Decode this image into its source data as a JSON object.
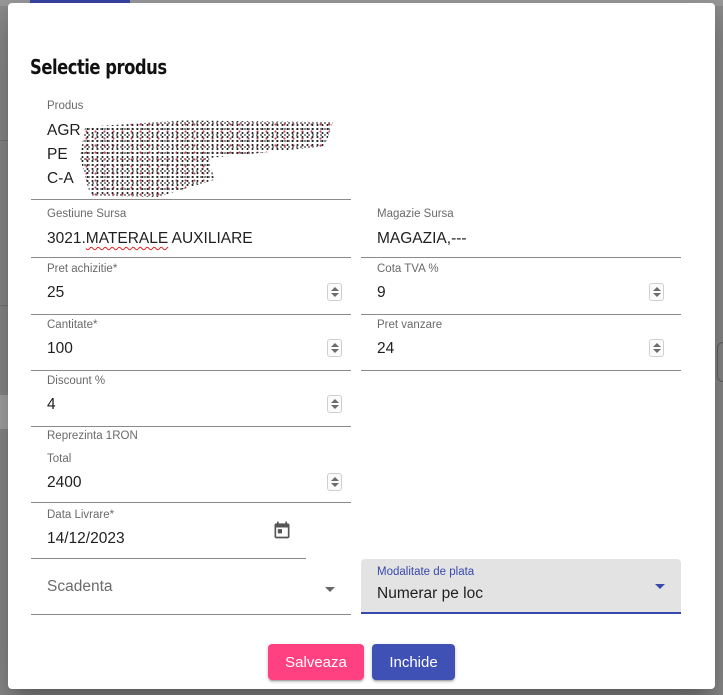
{
  "dialog": {
    "title": "Selectie produs"
  },
  "product": {
    "label": "Produs",
    "line1": "AGR",
    "line2": "PE",
    "line3": "C-A"
  },
  "gestiune": {
    "label": "Gestiune Sursa",
    "value_code": "3021.",
    "value_name": "MATERALE",
    "value_rest": " AUXILIARE"
  },
  "magazie": {
    "label": "Magazie Sursa",
    "value": "MAGAZIA,---"
  },
  "pret_achizitie": {
    "label": "Pret achizitie*",
    "value": "25"
  },
  "cota_tva": {
    "label": "Cota TVA %",
    "value": "9"
  },
  "cantitate": {
    "label": "Cantitate*",
    "value": "100"
  },
  "pret_vanzare": {
    "label": "Pret vanzare",
    "value": "24"
  },
  "discount": {
    "label": "Discount %",
    "value": "4",
    "note": "Reprezinta 1RON"
  },
  "total": {
    "label": "Total",
    "value": "2400"
  },
  "data_livrare": {
    "label": "Data Livrare*",
    "value": "14/12/2023",
    "icon": "calendar-icon"
  },
  "scadenta": {
    "placeholder": "Scadenta"
  },
  "modalitate": {
    "label": "Modalitate de plata",
    "value": "Numerar pe loc"
  },
  "buttons": {
    "save": "Salveaza",
    "close": "Inchide"
  },
  "colors": {
    "primary": "#3f51b5",
    "accent": "#ff4081"
  }
}
